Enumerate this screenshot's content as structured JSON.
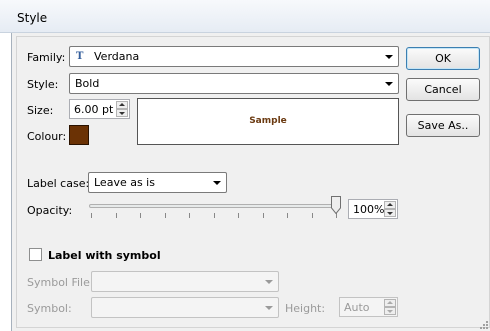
{
  "window": {
    "title": "Style"
  },
  "font": {
    "family_label": "Family:",
    "family_value": "Verdana",
    "family_icon": "truetype-font-icon",
    "style_label": "Style:",
    "style_value": "Bold",
    "size_label": "Size:",
    "size_value": "6.00 pt",
    "colour_label": "Colour:",
    "colour_value": "#6b3205",
    "sample_text": "Sample"
  },
  "buttons": {
    "ok": "OK",
    "cancel": "Cancel",
    "save_as": "Save As.."
  },
  "label_case": {
    "label": "Label case:",
    "value": "Leave as is"
  },
  "opacity": {
    "label": "Opacity:",
    "value": "100%",
    "level": 1.0
  },
  "symbol": {
    "checkbox_label": "Label with symbol",
    "checked": false,
    "file_label": "Symbol File:",
    "file_value": "",
    "symbol_label": "Symbol:",
    "symbol_value": "",
    "height_label": "Height:",
    "height_value": "Auto"
  }
}
